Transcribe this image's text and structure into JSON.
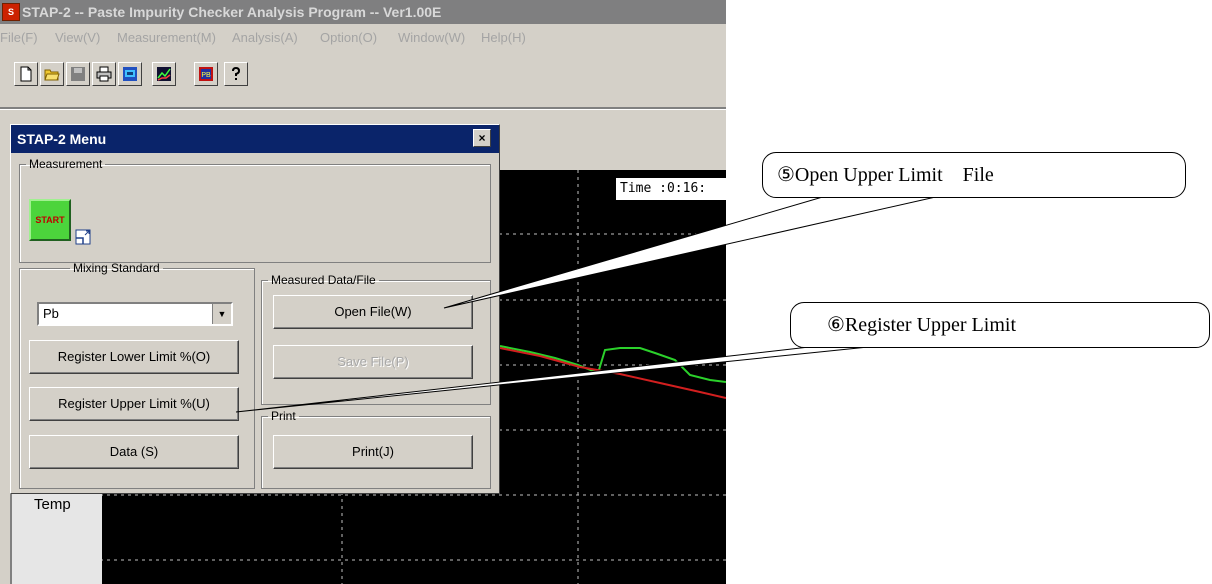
{
  "window": {
    "title": "STAP-2  -- Paste Impurity Checker Analysis Program --  Ver1.00E",
    "icon": "app-logo-icon"
  },
  "menubar": {
    "items": [
      "File(F)",
      "View(V)",
      "Measurement(M)",
      "Analysis(A)",
      "Option(O)",
      "Window(W)",
      "Help(H)"
    ]
  },
  "toolbar": {
    "buttons": [
      "new-file-icon",
      "open-folder-icon",
      "save-icon",
      "print-icon",
      "monitor-icon",
      "chart-icon",
      "pb-graph-icon",
      "help-icon"
    ]
  },
  "graph": {
    "time_label": "Time :0:16:",
    "temp_label": "Temp",
    "colors": {
      "background": "#000000",
      "green_trace": "#2bd12b",
      "red_trace": "#d21f1f",
      "grid": "#bfbfbf"
    }
  },
  "menu_dialog": {
    "title": "STAP-2 Menu",
    "close_label": "×",
    "measurement": {
      "group_title": "Measurement",
      "start_label": "START"
    },
    "mixing_standard": {
      "group_title": "Mixing Standard",
      "selected": "Pb",
      "buttons": {
        "register_lower": "Register Lower Limit %(O)",
        "register_upper": "Register Upper Limit %(U)",
        "data": "Data (S)"
      }
    },
    "measured_data": {
      "group_title": "Measured Data/File",
      "open_file": "Open File(W)",
      "save_file": "Save File(P)"
    },
    "print": {
      "group_title": "Print",
      "print_button": "Print(J)"
    }
  },
  "callouts": {
    "open_upper_limit_file": "⑤Open Upper Limit　File",
    "register_upper_limit": "⑥Register Upper Limit"
  }
}
